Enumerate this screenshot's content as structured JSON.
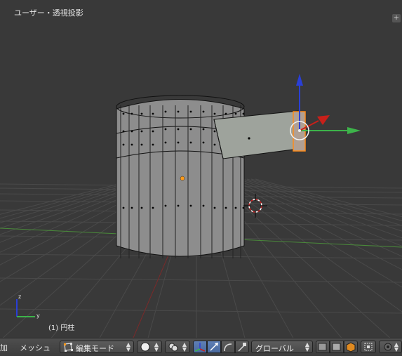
{
  "viewport": {
    "title": "ユーザー・透視投影",
    "object_name": "(1) 円柱",
    "corner_button": "+",
    "axis_labels": {
      "z": "z",
      "y": "y"
    }
  },
  "header": {
    "add_menu": "加",
    "mesh_menu": "メッシュ",
    "mode_selector": "編集モード",
    "orientation_selector": "グローバル"
  },
  "colors": {
    "viewport_bg": "#393939",
    "axis_x": "#c8201a",
    "axis_y": "#3db34a",
    "axis_z": "#2a3fd6",
    "selection": "#ff8c1a"
  }
}
